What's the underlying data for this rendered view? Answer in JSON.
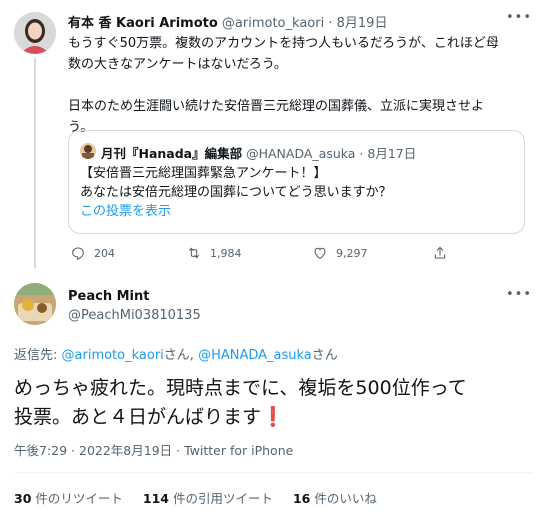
{
  "parent_tweet": {
    "name": "有本 香 Kaori Arimoto",
    "handle": "@arimoto_kaori",
    "sep": "·",
    "date": "8月19日",
    "text1": "もうすぐ50万票。複数のアカウントを持つ人もいるだろうが、これほど母",
    "text2": "数の大きなアンケートはないだろう。",
    "text3": "日本のため生涯闘い続けた安倍晋三元総理の国葬儀、立派に実現させよ",
    "text4": "う。",
    "quote": {
      "name": "月刊『Hanada』編集部",
      "handle": "@HANADA_asuka",
      "sep": "·",
      "date": "8月17日",
      "line1": "【安倍晋三元総理国葬緊急アンケート！】",
      "line2": "あなたは安倍元総理の国葬についてどう思いますか？",
      "link": "この投票を表示"
    },
    "stats": {
      "replies": "204",
      "retweets": "1,984",
      "likes": "9,297"
    }
  },
  "main_tweet": {
    "name": "Peach Mint",
    "handle": "@PeachMi03810135",
    "reply_prefix": "返信先: ",
    "reply_user1": "@arimoto_kaori",
    "reply_san1": "さん, ",
    "reply_user2": "@HANADA_asuka",
    "reply_san2": "さん",
    "text1": "めっちゃ疲れた。現時点までに、複垢を500位作って",
    "text2": "投票。あと４日がんばります",
    "emoji": "❗",
    "meta": "午後7:29 · 2022年8月19日 · Twitter for iPhone",
    "counts": {
      "retweets": "30",
      "retweets_label": " 件のリツイート",
      "quotes": "114",
      "quotes_label": " 件の引用ツイート",
      "likes": "16",
      "likes_label": " 件のいいね"
    }
  },
  "icons": [
    "more-icon",
    "reply-icon",
    "retweet-icon",
    "like-icon",
    "share-icon"
  ],
  "colors": {
    "link": "#1d9bf0",
    "muted": "#536471",
    "text": "#0f1419",
    "border": "#cfd9de",
    "emoji": "#d8232f"
  }
}
